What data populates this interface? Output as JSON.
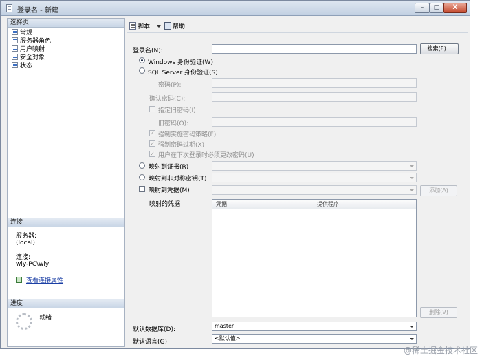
{
  "window": {
    "title": "登录名 - 新建",
    "controls": {
      "minimize": "–",
      "maximize": "□",
      "close": "X"
    }
  },
  "left_pane": {
    "select_page_header": "选择页",
    "pages": [
      "常规",
      "服务器角色",
      "用户映射",
      "安全对象",
      "状态"
    ],
    "connection_header": "连接",
    "server_label": "服务器:",
    "server_value": "(local)",
    "connection_label": "连接:",
    "connection_value": "wly-PC\\wly",
    "view_properties_link": "查看连接属性",
    "progress_header": "进度",
    "progress_status": "就绪"
  },
  "toolbar": {
    "script_label": "脚本",
    "help_label": "帮助"
  },
  "form": {
    "login_name_label": "登录名(N):",
    "login_name_value": "",
    "search_button": "搜索(E)...",
    "windows_auth_label": "Windows 身份验证(W)",
    "windows_auth_selected": true,
    "sql_auth_label": "SQL Server 身份验证(S)",
    "password_label": "密码(P):",
    "confirm_password_label": "确认密码(C):",
    "specify_old_password_label": "指定旧密码(I)",
    "old_password_label": "旧密码(O):",
    "enforce_policy_label": "强制实施密码策略(F)",
    "enforce_expiration_label": "强制密码过期(X)",
    "must_change_label": "用户在下次登录时必须更改密码(U)",
    "map_cert_label": "映射到证书(R)",
    "map_asym_key_label": "映射到非对称密钥(T)",
    "map_credential_label": "映射到凭据(M)",
    "add_button": "添加(A)",
    "mapped_credentials_label": "映射的凭据",
    "grid_columns": [
      "凭据",
      "提供程序"
    ],
    "remove_button": "删除(V)",
    "default_db_label": "默认数据库(D):",
    "default_db_value": "master",
    "default_lang_label": "默认语言(G):",
    "default_lang_value": "<默认值>"
  },
  "watermark": "@稀土掘金技术社区",
  "colors": {
    "window_bg": "#f0f0f0",
    "titlebar": "#c2d0e2",
    "link": "#1b3fa5",
    "disabled_text": "#8e8e8e"
  }
}
